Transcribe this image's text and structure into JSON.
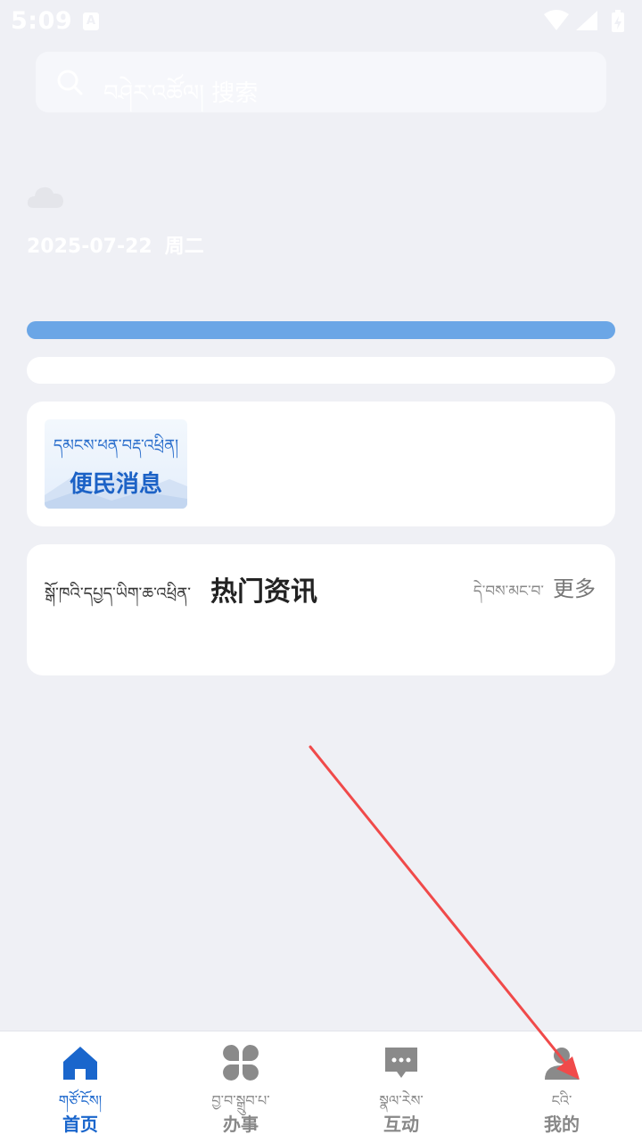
{
  "status_bar": {
    "time": "5:09",
    "notification_icon_letter": "A"
  },
  "search": {
    "placeholder": "བཤེར་འཚོལ། 搜索"
  },
  "weather": {
    "icon": "cloud-icon",
    "date": "2025-07-22",
    "weekday": "周二"
  },
  "notice_card": {
    "tibetan": "དམངས་ཕན་བརྡ་འཕྲིན།",
    "title": "便民消息"
  },
  "news": {
    "tibetan": "སྒོ་ཁའི་དཔྱད་ཡིག་ཆ་འཕྲིན་",
    "title": "热门资讯",
    "more_tibetan": "དེ་བས་མང་བ་",
    "more_label": "更多"
  },
  "bottom_nav": [
    {
      "icon": "home-icon",
      "tibetan": "གཙོ་ངོས།",
      "label": "首页",
      "active": true
    },
    {
      "icon": "grid-icon",
      "tibetan": "བྱ་བ་སྒྲུབ་པ་",
      "label": "办事",
      "active": false
    },
    {
      "icon": "chat-icon",
      "tibetan": "སྣལ་རེས་",
      "label": "互动",
      "active": false
    },
    {
      "icon": "person-icon",
      "tibetan": "ངའི་",
      "label": "我的",
      "active": false
    }
  ],
  "colors": {
    "background": "#eff0f5",
    "accent": "#1a66cc",
    "progress_bar": "#6ba6e6",
    "annotation_arrow": "#f04a4a"
  }
}
